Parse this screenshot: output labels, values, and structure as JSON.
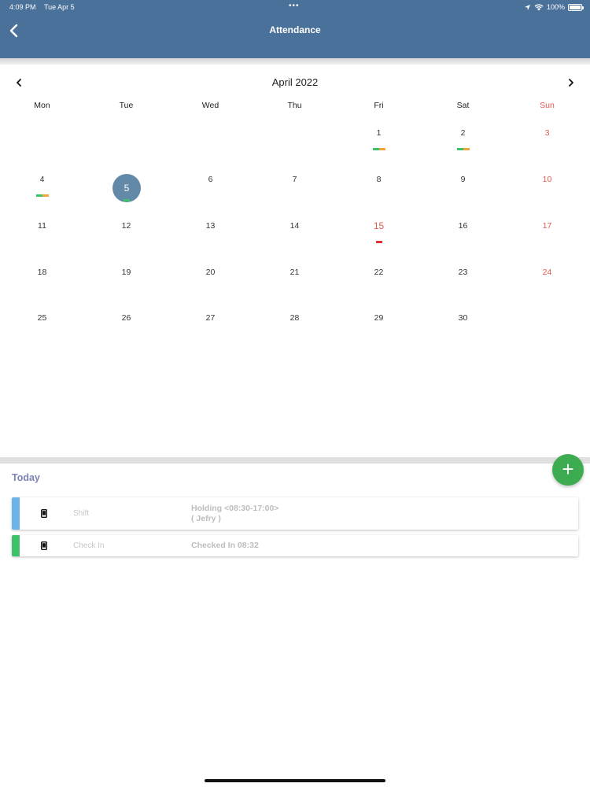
{
  "status_bar": {
    "time": "4:09 PM",
    "date": "Tue Apr 5",
    "dots": "•••",
    "battery": "100%"
  },
  "header": {
    "title": "Attendance",
    "back_icon": "chevron-left-icon",
    "background": "#4a7199"
  },
  "calendar": {
    "month_label": "April 2022",
    "weekdays": [
      "Mon",
      "Tue",
      "Wed",
      "Thu",
      "Fri",
      "Sat",
      "Sun"
    ],
    "selected_day": "5",
    "weeks": [
      [
        {
          "day": ""
        },
        {
          "day": ""
        },
        {
          "day": ""
        },
        {
          "day": ""
        },
        {
          "day": "1",
          "marks": [
            "green",
            "orange"
          ]
        },
        {
          "day": "2",
          "marks": [
            "green",
            "orange"
          ]
        },
        {
          "day": "3",
          "sunday": true
        }
      ],
      [
        {
          "day": "4",
          "marks": [
            "green",
            "orange"
          ]
        },
        {
          "day": "5",
          "selected": true,
          "marks": [
            "green"
          ]
        },
        {
          "day": "6"
        },
        {
          "day": "7"
        },
        {
          "day": "8"
        },
        {
          "day": "9"
        },
        {
          "day": "10",
          "sunday": true
        }
      ],
      [
        {
          "day": "11"
        },
        {
          "day": "12"
        },
        {
          "day": "13"
        },
        {
          "day": "14"
        },
        {
          "day": "15",
          "holiday": true,
          "marks": [
            "red"
          ]
        },
        {
          "day": "16"
        },
        {
          "day": "17",
          "sunday": true
        }
      ],
      [
        {
          "day": "18"
        },
        {
          "day": "19"
        },
        {
          "day": "20"
        },
        {
          "day": "21"
        },
        {
          "day": "22"
        },
        {
          "day": "23"
        },
        {
          "day": "24",
          "sunday": true
        }
      ],
      [
        {
          "day": "25"
        },
        {
          "day": "26"
        },
        {
          "day": "27"
        },
        {
          "day": "28"
        },
        {
          "day": "29"
        },
        {
          "day": "30"
        },
        {
          "day": ""
        }
      ]
    ],
    "colors": {
      "sunday": "#e05a4e",
      "mark_green": "#3dc26b",
      "mark_orange": "#f2a33c",
      "mark_red": "#e23131",
      "selected": "#6389a8"
    }
  },
  "today_section": {
    "label": "Today",
    "fab_label": "+",
    "cards": [
      {
        "type": "Shift",
        "detail_line1": "Holding <08:30-17:00>",
        "detail_line2": "( Jefry )",
        "bar_color": "#6cb4e8",
        "icon": "phone-icon"
      },
      {
        "type": "Check In",
        "detail_line1": "Checked In 08:32",
        "bar_color": "#3dc26b",
        "icon": "phone-icon"
      }
    ]
  }
}
